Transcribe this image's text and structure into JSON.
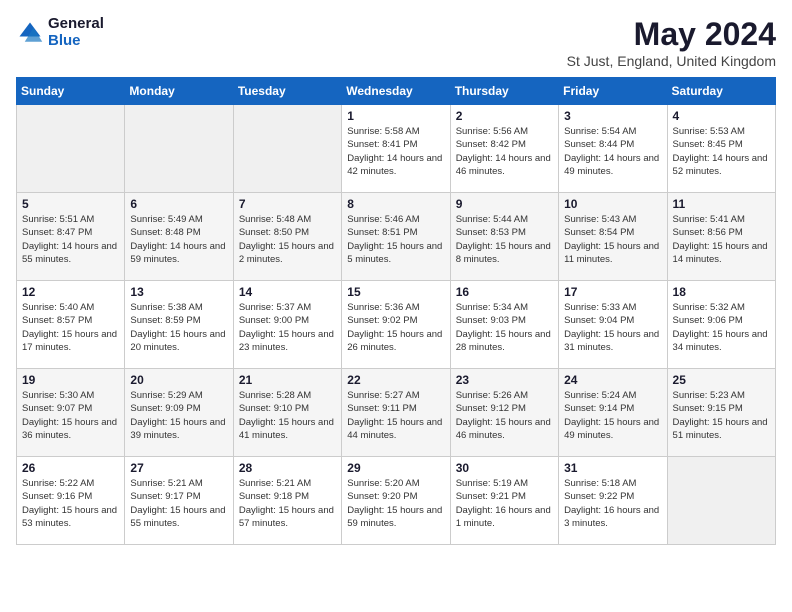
{
  "header": {
    "logo_general": "General",
    "logo_blue": "Blue",
    "month_title": "May 2024",
    "location": "St Just, England, United Kingdom"
  },
  "days_of_week": [
    "Sunday",
    "Monday",
    "Tuesday",
    "Wednesday",
    "Thursday",
    "Friday",
    "Saturday"
  ],
  "weeks": [
    [
      {
        "num": "",
        "sunrise": "",
        "sunset": "",
        "daylight": ""
      },
      {
        "num": "",
        "sunrise": "",
        "sunset": "",
        "daylight": ""
      },
      {
        "num": "",
        "sunrise": "",
        "sunset": "",
        "daylight": ""
      },
      {
        "num": "1",
        "sunrise": "Sunrise: 5:58 AM",
        "sunset": "Sunset: 8:41 PM",
        "daylight": "Daylight: 14 hours and 42 minutes."
      },
      {
        "num": "2",
        "sunrise": "Sunrise: 5:56 AM",
        "sunset": "Sunset: 8:42 PM",
        "daylight": "Daylight: 14 hours and 46 minutes."
      },
      {
        "num": "3",
        "sunrise": "Sunrise: 5:54 AM",
        "sunset": "Sunset: 8:44 PM",
        "daylight": "Daylight: 14 hours and 49 minutes."
      },
      {
        "num": "4",
        "sunrise": "Sunrise: 5:53 AM",
        "sunset": "Sunset: 8:45 PM",
        "daylight": "Daylight: 14 hours and 52 minutes."
      }
    ],
    [
      {
        "num": "5",
        "sunrise": "Sunrise: 5:51 AM",
        "sunset": "Sunset: 8:47 PM",
        "daylight": "Daylight: 14 hours and 55 minutes."
      },
      {
        "num": "6",
        "sunrise": "Sunrise: 5:49 AM",
        "sunset": "Sunset: 8:48 PM",
        "daylight": "Daylight: 14 hours and 59 minutes."
      },
      {
        "num": "7",
        "sunrise": "Sunrise: 5:48 AM",
        "sunset": "Sunset: 8:50 PM",
        "daylight": "Daylight: 15 hours and 2 minutes."
      },
      {
        "num": "8",
        "sunrise": "Sunrise: 5:46 AM",
        "sunset": "Sunset: 8:51 PM",
        "daylight": "Daylight: 15 hours and 5 minutes."
      },
      {
        "num": "9",
        "sunrise": "Sunrise: 5:44 AM",
        "sunset": "Sunset: 8:53 PM",
        "daylight": "Daylight: 15 hours and 8 minutes."
      },
      {
        "num": "10",
        "sunrise": "Sunrise: 5:43 AM",
        "sunset": "Sunset: 8:54 PM",
        "daylight": "Daylight: 15 hours and 11 minutes."
      },
      {
        "num": "11",
        "sunrise": "Sunrise: 5:41 AM",
        "sunset": "Sunset: 8:56 PM",
        "daylight": "Daylight: 15 hours and 14 minutes."
      }
    ],
    [
      {
        "num": "12",
        "sunrise": "Sunrise: 5:40 AM",
        "sunset": "Sunset: 8:57 PM",
        "daylight": "Daylight: 15 hours and 17 minutes."
      },
      {
        "num": "13",
        "sunrise": "Sunrise: 5:38 AM",
        "sunset": "Sunset: 8:59 PM",
        "daylight": "Daylight: 15 hours and 20 minutes."
      },
      {
        "num": "14",
        "sunrise": "Sunrise: 5:37 AM",
        "sunset": "Sunset: 9:00 PM",
        "daylight": "Daylight: 15 hours and 23 minutes."
      },
      {
        "num": "15",
        "sunrise": "Sunrise: 5:36 AM",
        "sunset": "Sunset: 9:02 PM",
        "daylight": "Daylight: 15 hours and 26 minutes."
      },
      {
        "num": "16",
        "sunrise": "Sunrise: 5:34 AM",
        "sunset": "Sunset: 9:03 PM",
        "daylight": "Daylight: 15 hours and 28 minutes."
      },
      {
        "num": "17",
        "sunrise": "Sunrise: 5:33 AM",
        "sunset": "Sunset: 9:04 PM",
        "daylight": "Daylight: 15 hours and 31 minutes."
      },
      {
        "num": "18",
        "sunrise": "Sunrise: 5:32 AM",
        "sunset": "Sunset: 9:06 PM",
        "daylight": "Daylight: 15 hours and 34 minutes."
      }
    ],
    [
      {
        "num": "19",
        "sunrise": "Sunrise: 5:30 AM",
        "sunset": "Sunset: 9:07 PM",
        "daylight": "Daylight: 15 hours and 36 minutes."
      },
      {
        "num": "20",
        "sunrise": "Sunrise: 5:29 AM",
        "sunset": "Sunset: 9:09 PM",
        "daylight": "Daylight: 15 hours and 39 minutes."
      },
      {
        "num": "21",
        "sunrise": "Sunrise: 5:28 AM",
        "sunset": "Sunset: 9:10 PM",
        "daylight": "Daylight: 15 hours and 41 minutes."
      },
      {
        "num": "22",
        "sunrise": "Sunrise: 5:27 AM",
        "sunset": "Sunset: 9:11 PM",
        "daylight": "Daylight: 15 hours and 44 minutes."
      },
      {
        "num": "23",
        "sunrise": "Sunrise: 5:26 AM",
        "sunset": "Sunset: 9:12 PM",
        "daylight": "Daylight: 15 hours and 46 minutes."
      },
      {
        "num": "24",
        "sunrise": "Sunrise: 5:24 AM",
        "sunset": "Sunset: 9:14 PM",
        "daylight": "Daylight: 15 hours and 49 minutes."
      },
      {
        "num": "25",
        "sunrise": "Sunrise: 5:23 AM",
        "sunset": "Sunset: 9:15 PM",
        "daylight": "Daylight: 15 hours and 51 minutes."
      }
    ],
    [
      {
        "num": "26",
        "sunrise": "Sunrise: 5:22 AM",
        "sunset": "Sunset: 9:16 PM",
        "daylight": "Daylight: 15 hours and 53 minutes."
      },
      {
        "num": "27",
        "sunrise": "Sunrise: 5:21 AM",
        "sunset": "Sunset: 9:17 PM",
        "daylight": "Daylight: 15 hours and 55 minutes."
      },
      {
        "num": "28",
        "sunrise": "Sunrise: 5:21 AM",
        "sunset": "Sunset: 9:18 PM",
        "daylight": "Daylight: 15 hours and 57 minutes."
      },
      {
        "num": "29",
        "sunrise": "Sunrise: 5:20 AM",
        "sunset": "Sunset: 9:20 PM",
        "daylight": "Daylight: 15 hours and 59 minutes."
      },
      {
        "num": "30",
        "sunrise": "Sunrise: 5:19 AM",
        "sunset": "Sunset: 9:21 PM",
        "daylight": "Daylight: 16 hours and 1 minute."
      },
      {
        "num": "31",
        "sunrise": "Sunrise: 5:18 AM",
        "sunset": "Sunset: 9:22 PM",
        "daylight": "Daylight: 16 hours and 3 minutes."
      },
      {
        "num": "",
        "sunrise": "",
        "sunset": "",
        "daylight": ""
      }
    ]
  ]
}
